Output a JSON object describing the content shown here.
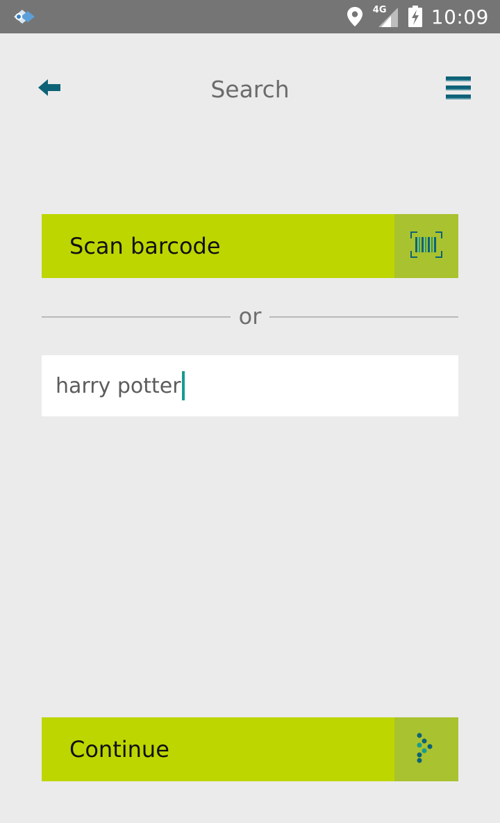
{
  "status_bar": {
    "time": "10:09",
    "network_label": "4G",
    "icons": [
      "app-logo-icon",
      "location-icon",
      "signal-icon",
      "battery-charging-icon"
    ]
  },
  "header": {
    "title": "Search",
    "back_icon": "arrow-left-icon",
    "menu_icon": "hamburger-menu-icon"
  },
  "scan": {
    "label": "Scan barcode",
    "icon": "barcode-scan-icon"
  },
  "divider": {
    "text": "or"
  },
  "search": {
    "value": "harry potter"
  },
  "continue": {
    "label": "Continue",
    "icon": "dotted-arrow-right-icon"
  },
  "colors": {
    "background": "#ebebeb",
    "status_bar": "#757575",
    "accent_green": "#bdd600",
    "accent_green_dark": "#a9c22f",
    "icon_teal": "#0e6277",
    "cursor_teal": "#179c8f"
  }
}
